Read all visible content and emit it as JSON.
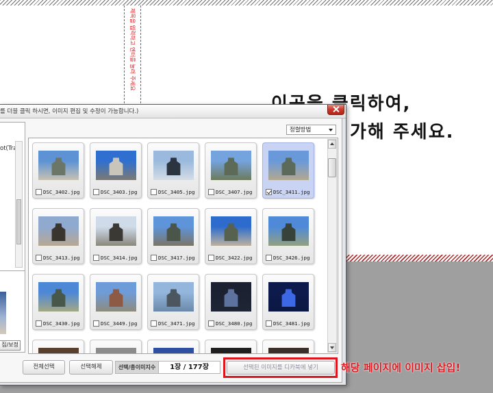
{
  "colors": {
    "accent_red": "#e0141c",
    "selected_card": "#c9d3f3",
    "page_gray": "#9f9f9f"
  },
  "page": {
    "title_guide": "제목을 입력하고 엔터를 눌러 주세요",
    "hint_line1": "이곳을 클릭하여,",
    "hint_line2": "가해 주세요.",
    "callout": "해당 페이지에 이미지 삽입!"
  },
  "dialog": {
    "title": "를 더블 클릭 하시면, 이미지 편집 및 수정이 가능합니다.)",
    "close_icon": "close-icon",
    "sort": {
      "label": "정렬방법",
      "icon": "chevron-down-icon"
    },
    "left_panel": {
      "tree_item": "ot(Tran",
      "edit_button": "집/보정"
    },
    "grid": {
      "thumbnails": [
        {
          "filename": "DSC_3402.jpg",
          "checked": false,
          "colors": [
            "#5d93d5",
            "#6b7668",
            "#c8c2b2"
          ]
        },
        {
          "filename": "DSC_3403.jpg",
          "checked": false,
          "colors": [
            "#2f6fd0",
            "#c9c5ba",
            "#7d7a72"
          ]
        },
        {
          "filename": "DSC_3405.jpg",
          "checked": false,
          "colors": [
            "#9ab9dc",
            "#2c3440",
            "#d5dde6"
          ]
        },
        {
          "filename": "DSC_3407.jpg",
          "checked": false,
          "colors": [
            "#74a3de",
            "#5d6a58",
            "#6d7a5a"
          ]
        },
        {
          "filename": "DSC_3411.jpg",
          "checked": true,
          "colors": [
            "#6a99da",
            "#5b6a5a",
            "#b4a88e"
          ]
        },
        {
          "filename": "DSC_3413.jpg",
          "checked": false,
          "colors": [
            "#8fa9cf",
            "#3a342e",
            "#b8a894"
          ]
        },
        {
          "filename": "DSC_3414.jpg",
          "checked": false,
          "colors": [
            "#d0dbea",
            "#3a3934",
            "#8a877c"
          ]
        },
        {
          "filename": "DSC_3417.jpg",
          "checked": false,
          "colors": [
            "#5e94da",
            "#4a564a",
            "#7a7566"
          ]
        },
        {
          "filename": "DSC_3422.jpg",
          "checked": false,
          "colors": [
            "#2d6ccc",
            "#56614f",
            "#bcb29e"
          ]
        },
        {
          "filename": "DSC_3426.jpg",
          "checked": false,
          "colors": [
            "#4e8ad8",
            "#37433a",
            "#93a080"
          ]
        },
        {
          "filename": "DSC_3430.jpg",
          "checked": false,
          "colors": [
            "#4d88d6",
            "#47574a",
            "#a3a884"
          ]
        },
        {
          "filename": "DSC_3449.jpg",
          "checked": false,
          "colors": [
            "#6e9cd8",
            "#8d5b45",
            "#8e8b7c"
          ]
        },
        {
          "filename": "DSC_3471.jpg",
          "checked": false,
          "colors": [
            "#94b6dd",
            "#4b565e",
            "#6b88a8"
          ]
        },
        {
          "filename": "DSC_3480.jpg",
          "checked": false,
          "colors": [
            "#1b2130",
            "#5e72a0",
            "#1e2535"
          ]
        },
        {
          "filename": "DSC_3481.jpg",
          "checked": false,
          "colors": [
            "#0d1a4c",
            "#3c68e6",
            "#0b1742"
          ]
        },
        {
          "colors": [
            "#5a3f2e",
            "#6a4a36",
            "#5a3f2e"
          ]
        },
        {
          "colors": [
            "#8c8c8c",
            "#777777",
            "#8c8c8c"
          ]
        },
        {
          "colors": [
            "#2f4fa0",
            "#3a5cb0",
            "#2f4fa0"
          ]
        },
        {
          "colors": [
            "#1f1f22",
            "#2a2a30",
            "#1f1f22"
          ]
        },
        {
          "colors": [
            "#3b2f29",
            "#4a3a30",
            "#3b2f29"
          ]
        }
      ]
    },
    "footer": {
      "select_all": "전체선택",
      "deselect": "선택해제",
      "count_label": "선택/총이미지수",
      "count_value": "1장 / 177장",
      "insert_button": "선택된 이미지를 디카북에 넣기"
    }
  }
}
